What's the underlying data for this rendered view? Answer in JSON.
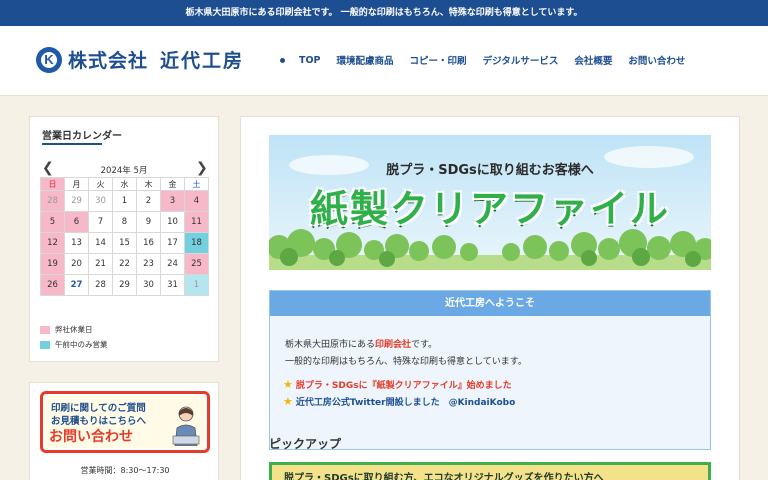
{
  "topbar": {
    "text": "栃木県大田原市にある印刷会社です。 一般的な印刷はもちろん、特殊な印刷も得意としています。"
  },
  "header": {
    "logo_company_type": "株式会社",
    "logo_name": "近代工房",
    "nav": [
      "TOP",
      "環境配慮商品",
      "コピー・印刷",
      "デジタルサービス",
      "会社概要",
      "お問い合わせ"
    ]
  },
  "calendar": {
    "title": "営業日カレンダー",
    "month_label": "2024年 5月",
    "weekdays": [
      "日",
      "月",
      "火",
      "水",
      "木",
      "金",
      "土"
    ],
    "weeks": [
      [
        "28",
        "29",
        "30",
        "1",
        "2",
        "3",
        "4"
      ],
      [
        "5",
        "6",
        "7",
        "8",
        "9",
        "10",
        "11"
      ],
      [
        "12",
        "13",
        "14",
        "15",
        "16",
        "17",
        "18"
      ],
      [
        "19",
        "20",
        "21",
        "22",
        "23",
        "24",
        "25"
      ],
      [
        "26",
        "27",
        "28",
        "29",
        "30",
        "31",
        "1"
      ]
    ],
    "legend_holiday": "弊社休業日",
    "legend_morning": "午前中のみ営業",
    "colors": {
      "holiday": "#f7b8c9",
      "morning": "#74d0de"
    }
  },
  "contact_banner": {
    "line1": "印刷に関してのご質問",
    "line2": "お見積もりはこちらへ",
    "line3": "お問い合わせ",
    "hours": "営業時間：8:30〜17:30"
  },
  "hero": {
    "subtitle": "脱プラ・SDGsに取り組むお客様へ",
    "title": "紙製クリアファイル"
  },
  "welcome": {
    "heading": "近代工房へようこそ",
    "line1_prefix": "栃木県大田原市にある",
    "line1_highlight": "印刷会社",
    "line1_suffix": "です。",
    "line2": "一般的な印刷はもちろん、特殊な印刷も得意としています。",
    "news1": "脱プラ・SDGsに『紙製クリアファイル』始めました",
    "news2": "近代工房公式Twitter開設しました　@KindaiKobo"
  },
  "pickup": {
    "title": "ピックアップ",
    "banner_text": "脱プラ・SDGsに取り組む方、エコなオリジナルグッズを作りたい方へ"
  },
  "colors": {
    "brand_blue": "#1e4e92",
    "accent_red": "#e63b2a",
    "green": "#2fb04a"
  }
}
